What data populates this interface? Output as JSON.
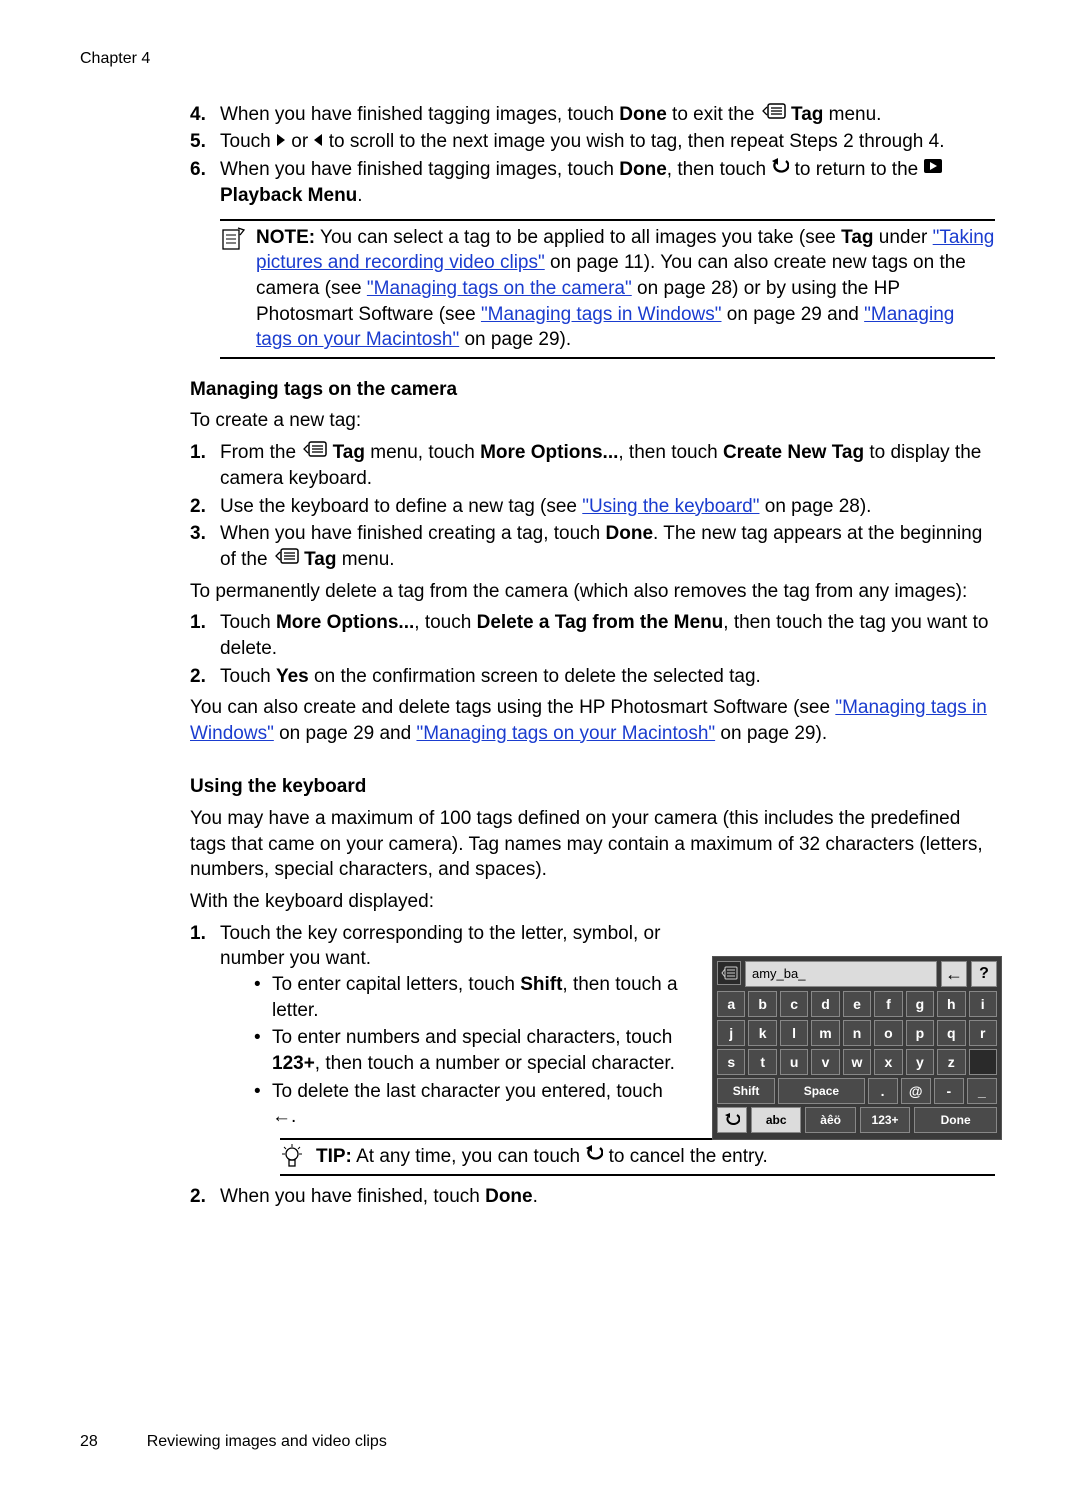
{
  "chapter": "Chapter 4",
  "steps_top": {
    "s4": {
      "num": "4.",
      "pre": "When you have finished tagging images, touch ",
      "done": "Done",
      "mid": " to exit the ",
      "tag": "Tag",
      "post": " menu."
    },
    "s5": {
      "num": "5.",
      "pre": "Touch ",
      "mid": " or ",
      "post": " to scroll to the next image you wish to tag, then repeat Steps 2 through 4."
    },
    "s6": {
      "num": "6.",
      "pre": "When you have finished tagging images, touch ",
      "done": "Done",
      "mid": ", then touch ",
      "post": " to return to the ",
      "pb": "Playback Menu",
      "end": "."
    }
  },
  "note1": {
    "label": "NOTE:",
    "t1": "  You can select a tag to be applied to all images you take (see ",
    "tag": "Tag",
    "t2": " under ",
    "link1": "\"Taking pictures and recording video clips\"",
    "t3": " on page 11). You can also create new tags on the camera (see ",
    "link2": "\"Managing tags on the camera\"",
    "t4": " on page 28) or by using the HP Photosmart Software (see ",
    "link3": "\"Managing tags in Windows\"",
    "t5": " on page 29 and ",
    "link4": "\"Managing tags on your Macintosh\"",
    "t6": " on page 29)."
  },
  "h_manage": "Managing tags on the camera",
  "p_create": "To create a new tag:",
  "create_steps": {
    "s1": {
      "num": "1.",
      "pre": "From the ",
      "tag": "Tag",
      "mid": " menu, touch ",
      "mo": "More Options...",
      "mid2": ", then touch ",
      "cnt": "Create New Tag",
      "post": " to display the camera keyboard."
    },
    "s2": {
      "num": "2.",
      "pre": "Use the keyboard to define a new tag (see ",
      "link": "\"Using the keyboard\"",
      "post": " on page 28)."
    },
    "s3": {
      "num": "3.",
      "pre": "When you have finished creating a tag, touch ",
      "done": "Done",
      "mid": ". The new tag appears at the beginning of the ",
      "tag": "Tag",
      "post": " menu."
    }
  },
  "p_delete": "To permanently delete a tag from the camera (which also removes the tag from any images):",
  "delete_steps": {
    "s1": {
      "num": "1.",
      "pre": "Touch ",
      "mo": "More Options...",
      "mid": ", touch ",
      "dt": "Delete a Tag from the Menu",
      "post": ", then touch the tag you want to delete."
    },
    "s2": {
      "num": "2.",
      "pre": "Touch ",
      "yes": "Yes",
      "post": " on the confirmation screen to delete the selected tag."
    }
  },
  "p_also": {
    "pre": "You can also create and delete tags using the HP Photosmart Software (see ",
    "link1": "\"Managing tags in Windows\"",
    "mid": " on page 29 and ",
    "link2": "\"Managing tags on your Macintosh\"",
    "post": " on page 29)."
  },
  "h_kbd": "Using the keyboard",
  "p_kbd1": "You may have a maximum of 100 tags defined on your camera (this includes the predefined tags that came on your camera). Tag names may contain a maximum of 32 characters (letters, numbers, special characters, and spaces).",
  "p_kbd2": "With the keyboard displayed:",
  "kbd_steps": {
    "s1": {
      "num": "1.",
      "text": "Touch the key corresponding to the letter, symbol, or number you want.",
      "b1": {
        "pre": "To enter capital letters, touch ",
        "shift": "Shift",
        "post": ", then touch a letter."
      },
      "b2": {
        "pre": "To enter numbers and special characters, touch ",
        "n": "123+",
        "post": ", then touch a number or special character."
      },
      "b3": {
        "pre": "To delete the last character you entered, touch ",
        "arrow": "←",
        "post": "."
      }
    },
    "s2": {
      "num": "2.",
      "pre": "When you have finished, touch ",
      "done": "Done",
      "post": "."
    }
  },
  "tip": {
    "label": "TIP:",
    "pre": "  At any time, you can touch ",
    "post": " to cancel the entry."
  },
  "keyboard": {
    "input": "amy_ba_",
    "rows": [
      [
        "a",
        "b",
        "c",
        "d",
        "e",
        "f",
        "g",
        "h",
        "i"
      ],
      [
        "j",
        "k",
        "l",
        "m",
        "n",
        "o",
        "p",
        "q",
        "r"
      ],
      [
        "s",
        "t",
        "u",
        "v",
        "w",
        "x",
        "y",
        "z",
        ""
      ]
    ],
    "fnrow": [
      "Shift",
      "Space",
      ".",
      "@",
      "-",
      "_"
    ],
    "bottom": [
      "abc",
      "àêö",
      "123+",
      "Done"
    ]
  },
  "footer": {
    "page": "28",
    "title": "Reviewing images and video clips"
  }
}
